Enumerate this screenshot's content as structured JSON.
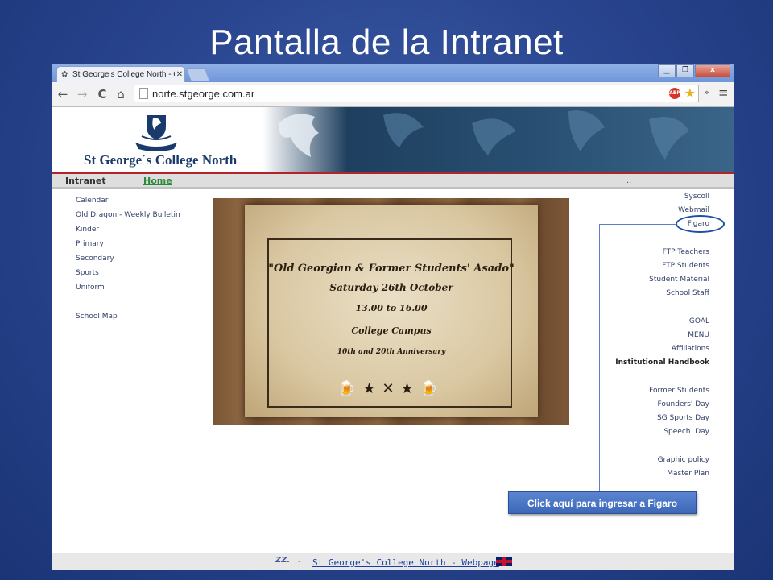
{
  "slide": {
    "title": "Pantalla de la Intranet"
  },
  "browser": {
    "tab_title": "St George's College North - C",
    "url": "norte.stgeorge.com.ar",
    "window_close": "x",
    "nav_back": "←",
    "nav_forward": "→",
    "nav_reload": "C",
    "nav_home": "⌂",
    "overflow": "»",
    "menu": "≡",
    "abp": "ABP"
  },
  "site": {
    "school_name": "St George´s College North",
    "nav": {
      "intranet": "Intranet",
      "home": "Home",
      "dots": ".."
    },
    "left_menu": [
      "Calendar",
      "Old Dragon - Weekly Bulletin",
      "Kinder",
      "Primary",
      "Secondary",
      "Sports",
      "Uniform",
      "",
      "School Map"
    ],
    "poster": {
      "line1": "\"Old Georgian & Former Students' Asado\"",
      "line2": "Saturday 26th October",
      "line3": "13.00 to 16.00",
      "line4": "College Campus",
      "line5": "10th and 20th Anniversary"
    },
    "right_menu": [
      {
        "label": "Syscoll",
        "bold": false
      },
      {
        "label": "Webmail",
        "bold": false
      },
      {
        "label": "Figaro",
        "bold": false
      },
      {
        "label": "",
        "bold": false
      },
      {
        "label": "FTP Teachers",
        "bold": false
      },
      {
        "label": "FTP Students",
        "bold": false
      },
      {
        "label": "Student Material",
        "bold": false
      },
      {
        "label": "School Staff",
        "bold": false
      },
      {
        "label": "",
        "bold": false
      },
      {
        "label": "GOAL",
        "bold": false
      },
      {
        "label": "MENU",
        "bold": false
      },
      {
        "label": "Affiliations",
        "bold": false
      },
      {
        "label": "Institutional Handbook",
        "bold": true
      },
      {
        "label": "",
        "bold": false
      },
      {
        "label": "Former Students",
        "bold": false
      },
      {
        "label": "Founders' Day",
        "bold": false
      },
      {
        "label": "SG Sports Day",
        "bold": false
      },
      {
        "label": "Speech  Day",
        "bold": false
      },
      {
        "label": "",
        "bold": false
      },
      {
        "label": "Graphic policy",
        "bold": false
      },
      {
        "label": "Master Plan",
        "bold": false
      }
    ],
    "footer": {
      "sep1": "-",
      "link": "St George's College North - Webpage",
      "sep2": "-"
    }
  },
  "callout": {
    "text": "Click aquí para ingresar a Figaro"
  },
  "colors": {
    "slide_bg": "#2a4690",
    "navbar_accent": "#b0242a",
    "home_link": "#2a8a3a",
    "callout_bg": "#4a74c4",
    "highlight_oval": "#1c4fa5"
  }
}
